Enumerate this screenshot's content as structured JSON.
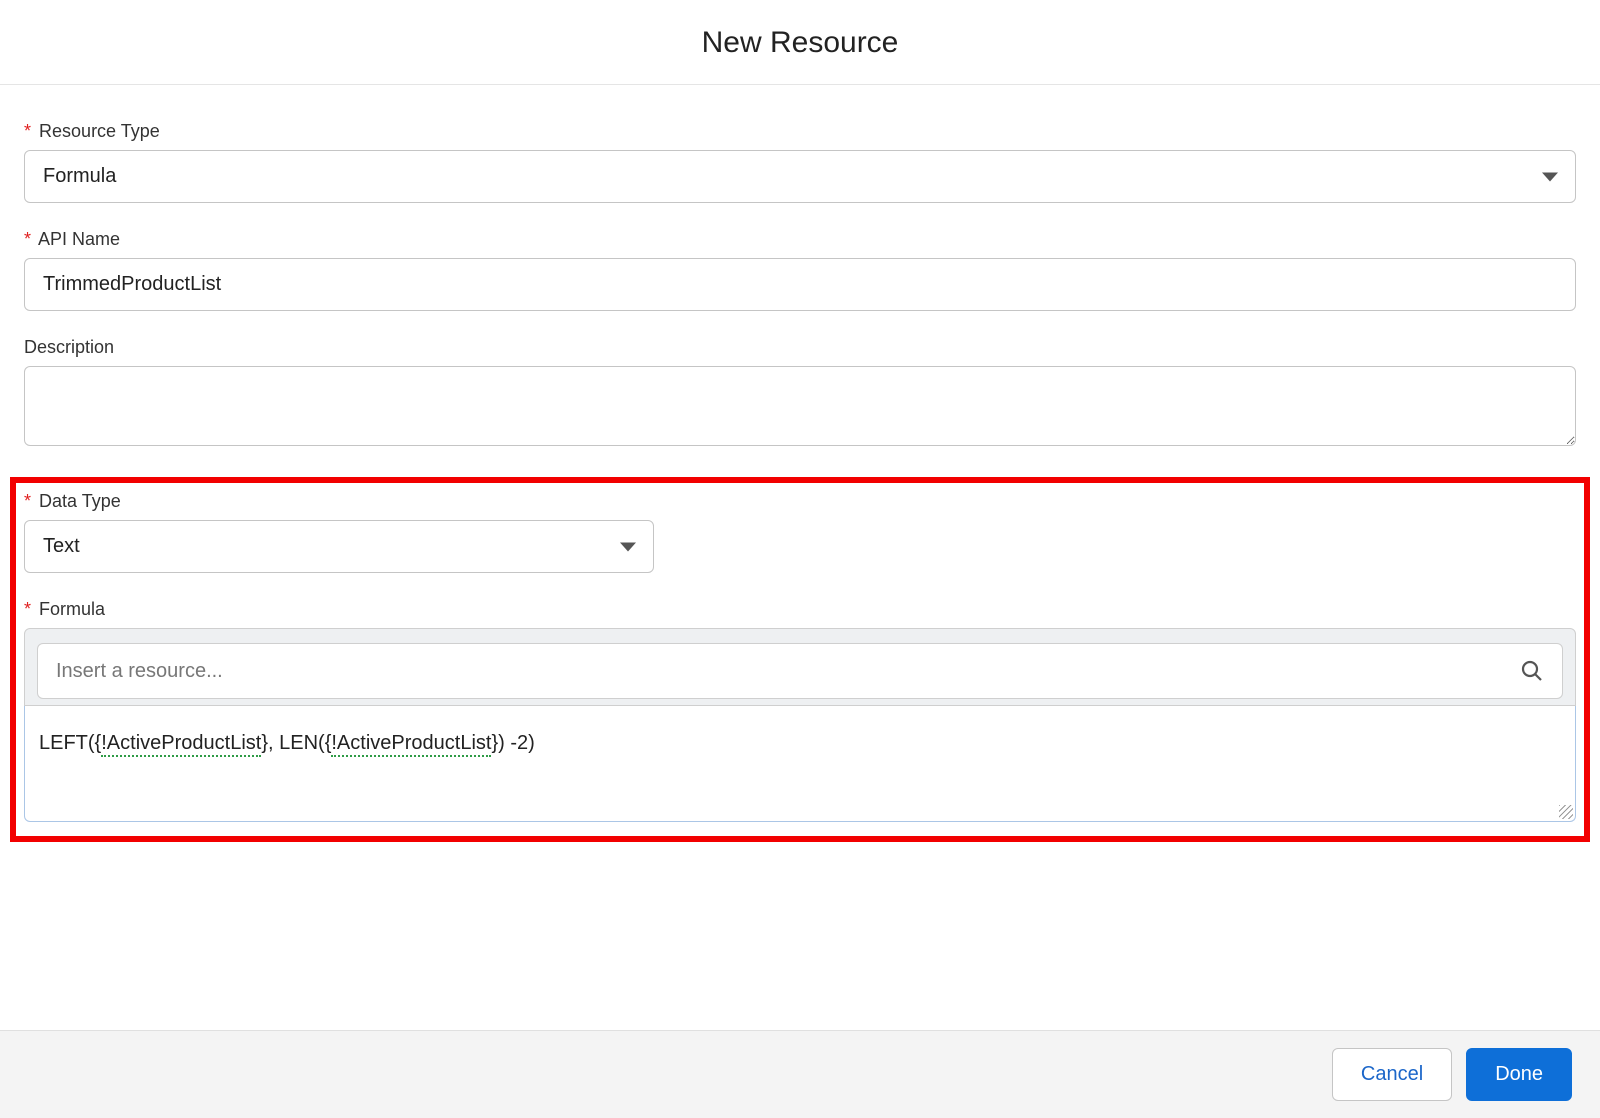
{
  "header": {
    "title": "New Resource"
  },
  "fields": {
    "resource_type": {
      "label": "Resource Type",
      "value": "Formula"
    },
    "api_name": {
      "label": "API Name",
      "value": "TrimmedProductList"
    },
    "description": {
      "label": "Description",
      "value": ""
    },
    "data_type": {
      "label": "Data Type",
      "value": "Text"
    },
    "formula": {
      "label": "Formula"
    },
    "resource_search": {
      "placeholder": "Insert a resource..."
    },
    "formula_body": {
      "prefix": "LEFT({",
      "var1": "!ActiveProductList",
      "mid": "}, LEN({",
      "var2": "!ActiveProductList",
      "suffix": "}) -2)"
    }
  },
  "footer": {
    "cancel": "Cancel",
    "done": "Done"
  }
}
